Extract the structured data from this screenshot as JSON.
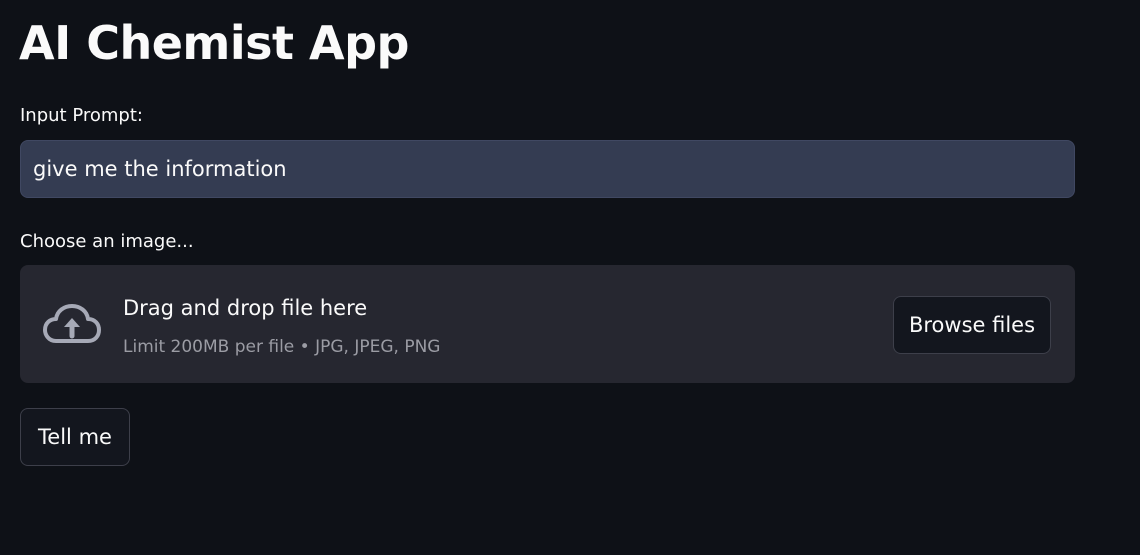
{
  "app": {
    "title": "AI Chemist App"
  },
  "prompt": {
    "label": "Input Prompt:",
    "value": "give me the information"
  },
  "uploader": {
    "label": "Choose an image...",
    "icon": "cloud-upload-icon",
    "drop_text": "Drag and drop file here",
    "limit_text": "Limit 200MB per file • JPG, JPEG, PNG",
    "browse_label": "Browse files"
  },
  "actions": {
    "submit_label": "Tell me"
  },
  "colors": {
    "background": "#0e1117",
    "input_background": "#343c52",
    "dropzone_background": "#262730",
    "text": "#fafafa",
    "muted_text": "#9b9ca4",
    "button_border": "#3d3f4a"
  }
}
